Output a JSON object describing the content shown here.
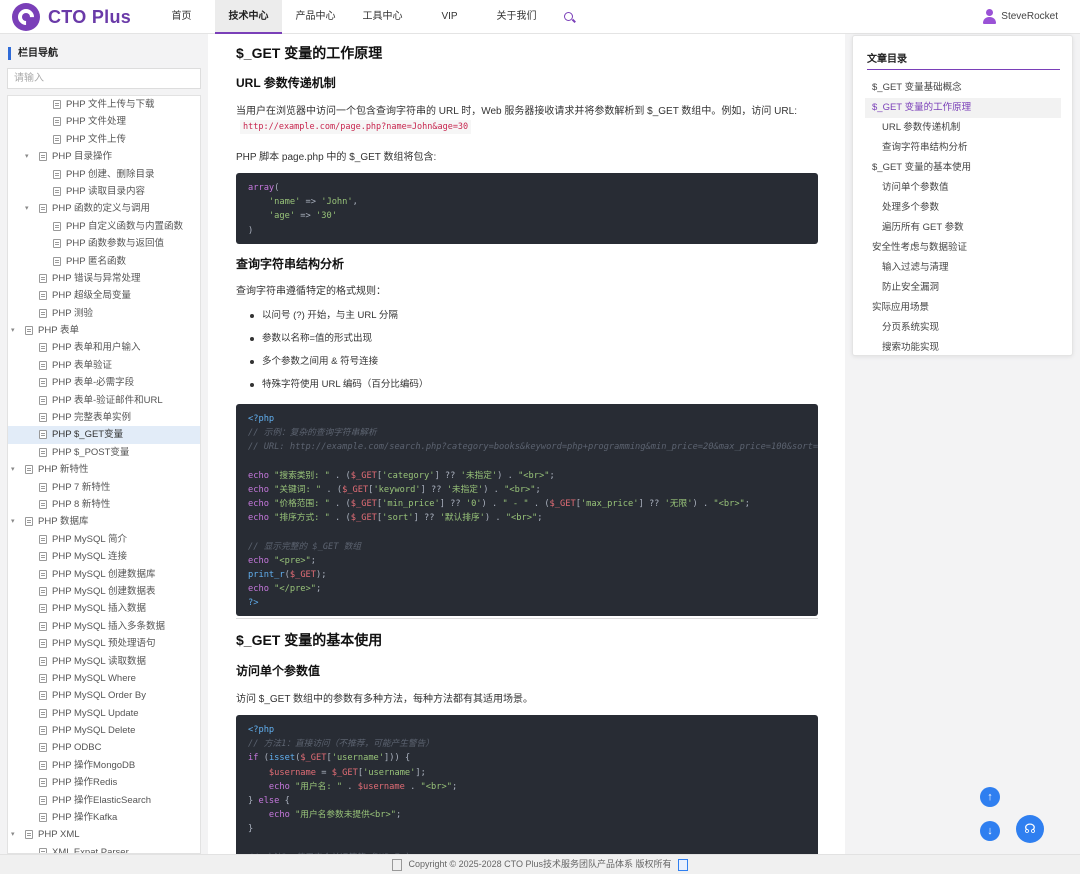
{
  "header": {
    "logo_text": "CTO Plus",
    "nav": [
      "首页",
      "技术中心",
      "产品中心",
      "工具中心",
      "VIP",
      "关于我们"
    ],
    "active_nav": "技术中心",
    "username": "SteveRocket"
  },
  "sidebar": {
    "title": "栏目导航",
    "search_placeholder": "请输入",
    "items": [
      {
        "label": "PHP 文件上传与下载",
        "level": 2
      },
      {
        "label": "PHP 文件处理",
        "level": 2
      },
      {
        "label": "PHP 文件上传",
        "level": 2
      },
      {
        "label": "PHP 目录操作",
        "level": 1,
        "expanded": true
      },
      {
        "label": "PHP 创建、删除目录",
        "level": 2
      },
      {
        "label": "PHP 读取目录内容",
        "level": 2
      },
      {
        "label": "PHP 函数的定义与调用",
        "level": 1,
        "expanded": true
      },
      {
        "label": "PHP 自定义函数与内置函数",
        "level": 2
      },
      {
        "label": "PHP 函数参数与返回值",
        "level": 2
      },
      {
        "label": "PHP 匿名函数",
        "level": 2
      },
      {
        "label": "PHP 错误与异常处理",
        "level": 1
      },
      {
        "label": "PHP 超级全局变量",
        "level": 1
      },
      {
        "label": "PHP 测验",
        "level": 1
      },
      {
        "label": "PHP 表单",
        "level": 0,
        "expanded": true
      },
      {
        "label": "PHP 表单和用户输入",
        "level": 1
      },
      {
        "label": "PHP 表单验证",
        "level": 1
      },
      {
        "label": "PHP 表单-必需字段",
        "level": 1
      },
      {
        "label": "PHP 表单-验证邮件和URL",
        "level": 1
      },
      {
        "label": "PHP 完整表单实例",
        "level": 1
      },
      {
        "label": "PHP $_GET变量",
        "level": 1,
        "active": true
      },
      {
        "label": "PHP $_POST变量",
        "level": 1
      },
      {
        "label": "PHP 新特性",
        "level": 0,
        "expanded": true
      },
      {
        "label": "PHP 7 新特性",
        "level": 1
      },
      {
        "label": "PHP 8 新特性",
        "level": 1
      },
      {
        "label": "PHP 数据库",
        "level": 0,
        "expanded": true
      },
      {
        "label": "PHP MySQL 简介",
        "level": 1
      },
      {
        "label": "PHP MySQL 连接",
        "level": 1
      },
      {
        "label": "PHP MySQL 创建数据库",
        "level": 1
      },
      {
        "label": "PHP MySQL 创建数据表",
        "level": 1
      },
      {
        "label": "PHP MySQL 插入数据",
        "level": 1
      },
      {
        "label": "PHP MySQL 插入多条数据",
        "level": 1
      },
      {
        "label": "PHP MySQL 预处理语句",
        "level": 1
      },
      {
        "label": "PHP MySQL 读取数据",
        "level": 1
      },
      {
        "label": "PHP MySQL Where",
        "level": 1
      },
      {
        "label": "PHP MySQL Order By",
        "level": 1
      },
      {
        "label": "PHP MySQL Update",
        "level": 1
      },
      {
        "label": "PHP MySQL Delete",
        "level": 1
      },
      {
        "label": "PHP ODBC",
        "level": 1
      },
      {
        "label": "PHP 操作MongoDB",
        "level": 1
      },
      {
        "label": "PHP 操作Redis",
        "level": 1
      },
      {
        "label": "PHP 操作ElasticSearch",
        "level": 1
      },
      {
        "label": "PHP 操作Kafka",
        "level": 1
      },
      {
        "label": "PHP XML",
        "level": 0,
        "expanded": true
      },
      {
        "label": "XML Expat Parser",
        "level": 1
      }
    ]
  },
  "article": {
    "h2_1": "$_GET 变量的工作原理",
    "h3_url": "URL 参数传递机制",
    "p_url": "当用户在浏览器中访问一个包含查询字符串的 URL 时，Web 服务器接收请求并将参数解析到 $_GET 数组中。例如，访问 URL:",
    "url_example": "http://example.com/page.php?name=John&age=30",
    "p_contains": "PHP 脚本 page.php 中的 $_GET 数组将包含:",
    "h3_query": "查询字符串结构分析",
    "p_query": "查询字符串遵循特定的格式规则：",
    "bullets": [
      "以问号 (?) 开始，与主 URL 分隔",
      "参数以名称=值的形式出现",
      "多个参数之间用 & 符号连接",
      "特殊字符使用 URL 编码（百分比编码）"
    ],
    "h2_2": "$_GET 变量的基本使用",
    "h3_access": "访问单个参数值",
    "p_access": "访问 $_GET 数组中的参数有多种方法，每种方法都有其适用场景。"
  },
  "toc": {
    "title": "文章目录",
    "items": [
      {
        "label": "$_GET 变量基础概念",
        "sub": false
      },
      {
        "label": "$_GET 变量的工作原理",
        "sub": false,
        "active": true
      },
      {
        "label": "URL 参数传递机制",
        "sub": true
      },
      {
        "label": "查询字符串结构分析",
        "sub": true
      },
      {
        "label": "$_GET 变量的基本使用",
        "sub": false
      },
      {
        "label": "访问单个参数值",
        "sub": true
      },
      {
        "label": "处理多个参数",
        "sub": true
      },
      {
        "label": "遍历所有 GET 参数",
        "sub": true
      },
      {
        "label": "安全性考虑与数据验证",
        "sub": false
      },
      {
        "label": "输入过滤与清理",
        "sub": true
      },
      {
        "label": "防止安全漏洞",
        "sub": true
      },
      {
        "label": "实际应用场景",
        "sub": false
      },
      {
        "label": "分页系统实现",
        "sub": true
      },
      {
        "label": "搜索功能实现",
        "sub": true
      }
    ]
  },
  "footer": {
    "copyright": "Copyright © 2025-2028 CTO Plus技术服务团队产品体系 版权所有"
  },
  "colors": {
    "accent": "#7a3fb8",
    "link_blue": "#2f6bd8",
    "fab_blue": "#2f7ff0",
    "code_bg": "#282c34"
  },
  "icons": {
    "search": "search-icon",
    "user": "user-icon",
    "back_to_top": "arrow-up-icon",
    "to_bottom": "arrow-down-icon",
    "support": "headset-icon"
  }
}
